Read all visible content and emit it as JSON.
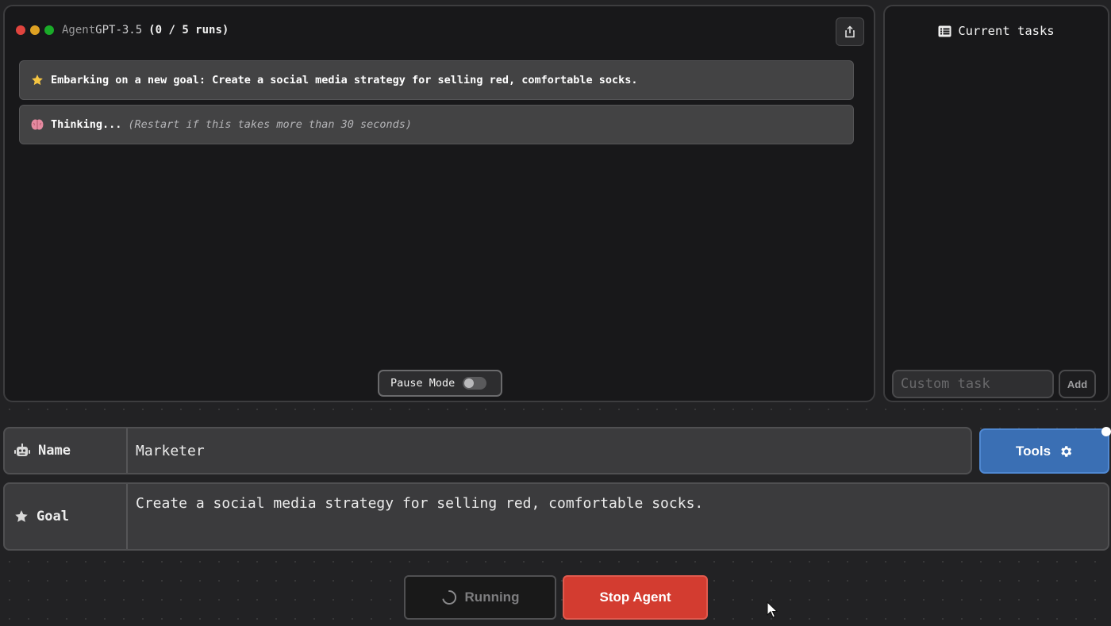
{
  "window": {
    "dots": [
      "#e0443e",
      "#dea123",
      "#1aab29"
    ],
    "title_prefix": "Agent",
    "title_model": "GPT-3.5",
    "runs": "(0 / 5 runs)"
  },
  "messages": [
    {
      "icon": "star-emoji-icon",
      "label": "Embarking on a new goal:",
      "text": "Create a social media strategy for selling red, comfortable socks."
    },
    {
      "icon": "brain-emoji-icon",
      "label": "Thinking...",
      "text": "(Restart if this takes more than 30 seconds)"
    }
  ],
  "pause_mode": {
    "label": "Pause Mode",
    "enabled": false
  },
  "tasks_panel": {
    "title": "Current tasks",
    "input_placeholder": "Custom task",
    "add_label": "Add"
  },
  "form": {
    "name_label": "Name",
    "name_value": "Marketer",
    "goal_label": "Goal",
    "goal_value": "Create a social media strategy for selling red, comfortable socks.",
    "tools_label": "Tools"
  },
  "actions": {
    "running_label": "Running",
    "stop_label": "Stop Agent"
  },
  "colors": {
    "accent_blue": "#3a6fb4",
    "stop_red": "#d33c30"
  }
}
